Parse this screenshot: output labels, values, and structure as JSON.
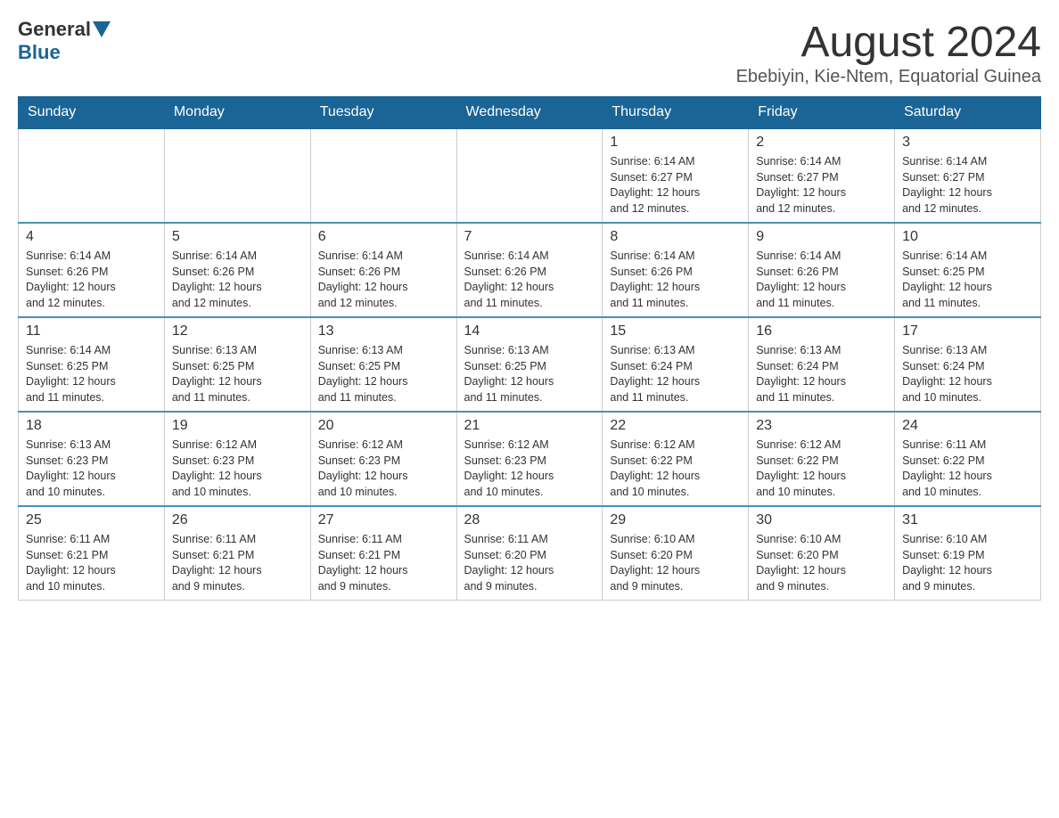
{
  "header": {
    "logo_general": "General",
    "logo_blue": "Blue",
    "month_year": "August 2024",
    "location": "Ebebiyin, Kie-Ntem, Equatorial Guinea"
  },
  "weekdays": [
    "Sunday",
    "Monday",
    "Tuesday",
    "Wednesday",
    "Thursday",
    "Friday",
    "Saturday"
  ],
  "weeks": [
    [
      {
        "day": "",
        "info": ""
      },
      {
        "day": "",
        "info": ""
      },
      {
        "day": "",
        "info": ""
      },
      {
        "day": "",
        "info": ""
      },
      {
        "day": "1",
        "info": "Sunrise: 6:14 AM\nSunset: 6:27 PM\nDaylight: 12 hours\nand 12 minutes."
      },
      {
        "day": "2",
        "info": "Sunrise: 6:14 AM\nSunset: 6:27 PM\nDaylight: 12 hours\nand 12 minutes."
      },
      {
        "day": "3",
        "info": "Sunrise: 6:14 AM\nSunset: 6:27 PM\nDaylight: 12 hours\nand 12 minutes."
      }
    ],
    [
      {
        "day": "4",
        "info": "Sunrise: 6:14 AM\nSunset: 6:26 PM\nDaylight: 12 hours\nand 12 minutes."
      },
      {
        "day": "5",
        "info": "Sunrise: 6:14 AM\nSunset: 6:26 PM\nDaylight: 12 hours\nand 12 minutes."
      },
      {
        "day": "6",
        "info": "Sunrise: 6:14 AM\nSunset: 6:26 PM\nDaylight: 12 hours\nand 12 minutes."
      },
      {
        "day": "7",
        "info": "Sunrise: 6:14 AM\nSunset: 6:26 PM\nDaylight: 12 hours\nand 11 minutes."
      },
      {
        "day": "8",
        "info": "Sunrise: 6:14 AM\nSunset: 6:26 PM\nDaylight: 12 hours\nand 11 minutes."
      },
      {
        "day": "9",
        "info": "Sunrise: 6:14 AM\nSunset: 6:26 PM\nDaylight: 12 hours\nand 11 minutes."
      },
      {
        "day": "10",
        "info": "Sunrise: 6:14 AM\nSunset: 6:25 PM\nDaylight: 12 hours\nand 11 minutes."
      }
    ],
    [
      {
        "day": "11",
        "info": "Sunrise: 6:14 AM\nSunset: 6:25 PM\nDaylight: 12 hours\nand 11 minutes."
      },
      {
        "day": "12",
        "info": "Sunrise: 6:13 AM\nSunset: 6:25 PM\nDaylight: 12 hours\nand 11 minutes."
      },
      {
        "day": "13",
        "info": "Sunrise: 6:13 AM\nSunset: 6:25 PM\nDaylight: 12 hours\nand 11 minutes."
      },
      {
        "day": "14",
        "info": "Sunrise: 6:13 AM\nSunset: 6:25 PM\nDaylight: 12 hours\nand 11 minutes."
      },
      {
        "day": "15",
        "info": "Sunrise: 6:13 AM\nSunset: 6:24 PM\nDaylight: 12 hours\nand 11 minutes."
      },
      {
        "day": "16",
        "info": "Sunrise: 6:13 AM\nSunset: 6:24 PM\nDaylight: 12 hours\nand 11 minutes."
      },
      {
        "day": "17",
        "info": "Sunrise: 6:13 AM\nSunset: 6:24 PM\nDaylight: 12 hours\nand 10 minutes."
      }
    ],
    [
      {
        "day": "18",
        "info": "Sunrise: 6:13 AM\nSunset: 6:23 PM\nDaylight: 12 hours\nand 10 minutes."
      },
      {
        "day": "19",
        "info": "Sunrise: 6:12 AM\nSunset: 6:23 PM\nDaylight: 12 hours\nand 10 minutes."
      },
      {
        "day": "20",
        "info": "Sunrise: 6:12 AM\nSunset: 6:23 PM\nDaylight: 12 hours\nand 10 minutes."
      },
      {
        "day": "21",
        "info": "Sunrise: 6:12 AM\nSunset: 6:23 PM\nDaylight: 12 hours\nand 10 minutes."
      },
      {
        "day": "22",
        "info": "Sunrise: 6:12 AM\nSunset: 6:22 PM\nDaylight: 12 hours\nand 10 minutes."
      },
      {
        "day": "23",
        "info": "Sunrise: 6:12 AM\nSunset: 6:22 PM\nDaylight: 12 hours\nand 10 minutes."
      },
      {
        "day": "24",
        "info": "Sunrise: 6:11 AM\nSunset: 6:22 PM\nDaylight: 12 hours\nand 10 minutes."
      }
    ],
    [
      {
        "day": "25",
        "info": "Sunrise: 6:11 AM\nSunset: 6:21 PM\nDaylight: 12 hours\nand 10 minutes."
      },
      {
        "day": "26",
        "info": "Sunrise: 6:11 AM\nSunset: 6:21 PM\nDaylight: 12 hours\nand 9 minutes."
      },
      {
        "day": "27",
        "info": "Sunrise: 6:11 AM\nSunset: 6:21 PM\nDaylight: 12 hours\nand 9 minutes."
      },
      {
        "day": "28",
        "info": "Sunrise: 6:11 AM\nSunset: 6:20 PM\nDaylight: 12 hours\nand 9 minutes."
      },
      {
        "day": "29",
        "info": "Sunrise: 6:10 AM\nSunset: 6:20 PM\nDaylight: 12 hours\nand 9 minutes."
      },
      {
        "day": "30",
        "info": "Sunrise: 6:10 AM\nSunset: 6:20 PM\nDaylight: 12 hours\nand 9 minutes."
      },
      {
        "day": "31",
        "info": "Sunrise: 6:10 AM\nSunset: 6:19 PM\nDaylight: 12 hours\nand 9 minutes."
      }
    ]
  ]
}
